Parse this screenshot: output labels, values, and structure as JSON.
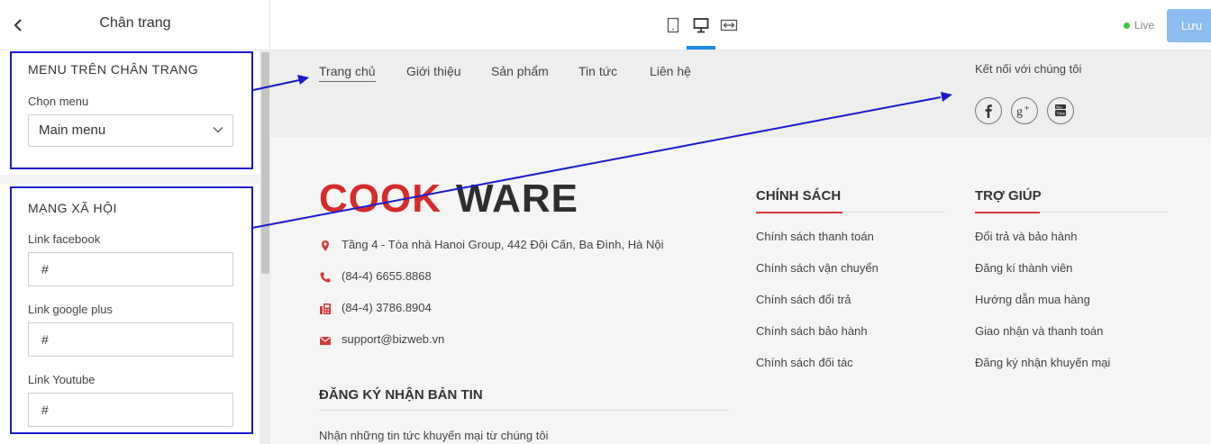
{
  "header": {
    "panel_title": "Chân trang",
    "live_label": "Live",
    "save_label": "Lưu",
    "active_device": "desktop",
    "accent_color": "#1a8be8",
    "save_color": "#8cbcf0",
    "live_color": "#3fc24a"
  },
  "sidebar": {
    "menu_section": {
      "title": "MENU TRÊN CHÂN TRANG",
      "select_label": "Chọn menu",
      "select_value": "Main menu"
    },
    "social_section": {
      "title": "MẠNG XÃ HỘI",
      "facebook_label": "Link facebook",
      "facebook_value": "#",
      "google_label": "Link google plus",
      "google_value": "#",
      "youtube_label": "Link Youtube",
      "youtube_value": "#"
    },
    "highlight_color": "#1a1acb"
  },
  "preview": {
    "nav_items": [
      "Trang chủ",
      "Giới thiệu",
      "Sản phẩm",
      "Tin tức",
      "Liên hệ"
    ],
    "active_nav": "Trang chủ",
    "connect_title": "Kết nối với chúng tôi",
    "social_icons": [
      "facebook-icon",
      "google-plus-icon",
      "youtube-icon"
    ],
    "logo": {
      "part1": "COOK",
      "part2": "WARE",
      "color1": "#d62b2b",
      "color2": "#2e2e2e"
    },
    "contact": {
      "address": "Tầng 4 - Tòa nhà Hanoi Group, 442 Đội Cấn, Ba Đình, Hà Nội",
      "phone": "(84-4) 6655.8868",
      "fax": "(84-4) 3786.8904",
      "email": "support@bizweb.vn"
    },
    "icon_color": "#d43a3a",
    "newsletter": {
      "title": "ĐĂNG KÝ NHẬN BẢN TIN",
      "text": "Nhận những tin tức khuyến mại từ chúng tôi"
    },
    "policy": {
      "title": "CHÍNH SÁCH",
      "links": [
        "Chính sách thanh toán",
        "Chính sách vận chuyển",
        "Chính sách đổi trả",
        "Chính sách bảo hành",
        "Chính sách đối tác"
      ]
    },
    "help": {
      "title": "TRỢ GIÚP",
      "links": [
        "Đổi trả và bảo hành",
        "Đăng kí thành viên",
        "Hướng dẫn mua hàng",
        "Giao nhận và thanh toán",
        "Đăng ký nhận khuyến mại"
      ]
    }
  }
}
